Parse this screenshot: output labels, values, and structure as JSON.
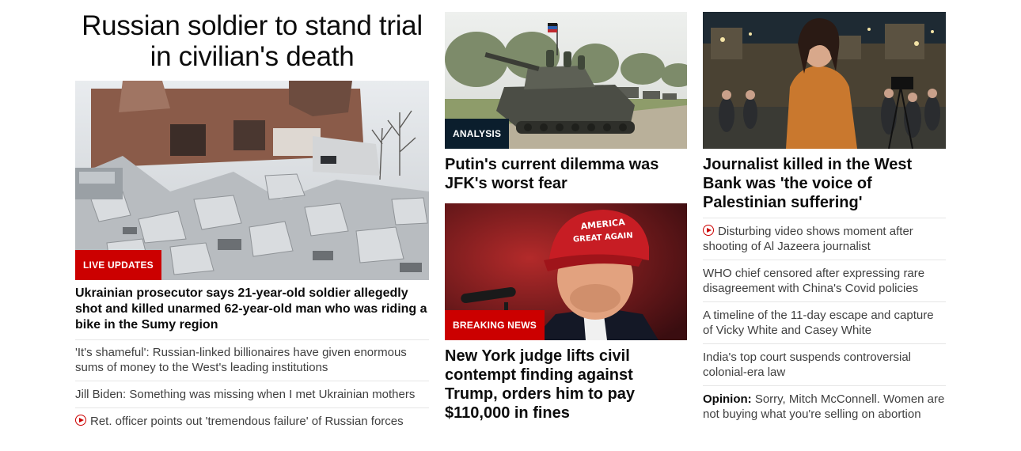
{
  "left": {
    "headline": "Russian soldier to stand trial in civilian's death",
    "badge": "LIVE UPDATES",
    "title": "Ukrainian prosecutor says 21-year-old soldier allegedly shot and killed unarmed 62-year-old man who was riding a bike in the Sumy region",
    "links": [
      {
        "text": "'It's shameful': Russian-linked billionaires have given enormous sums of money to the West's leading institutions",
        "video": false
      },
      {
        "text": "Jill Biden: Something was missing when I met Ukrainian mothers",
        "video": false
      },
      {
        "text": "Ret. officer points out 'tremendous failure' of Russian forces",
        "video": true
      }
    ]
  },
  "middle": {
    "top": {
      "badge": "ANALYSIS",
      "title": "Putin's current dilemma was JFK's worst fear"
    },
    "bottom": {
      "badge": "BREAKING NEWS",
      "cap_text_1": "AMERICA",
      "cap_text_2": "GREAT AGAIN",
      "title": "New York judge lifts civil contempt finding against Trump, orders him to pay $110,000 in fines"
    }
  },
  "right": {
    "title": "Journalist killed in the West Bank was 'the voice of Palestinian suffering'",
    "links": [
      {
        "text": "Disturbing video shows moment after shooting of Al Jazeera journalist",
        "video": true
      },
      {
        "text": "WHO chief censored after expressing rare disagreement with China's Covid policies",
        "video": false
      },
      {
        "text": "A timeline of the 11-day escape and capture of Vicky White and Casey White",
        "video": false
      },
      {
        "text": "India's top court suspends controversial colonial-era law",
        "video": false
      },
      {
        "text": "Sorry, Mitch McConnell. Women are not buying what you're selling on abortion",
        "video": false,
        "label": "Opinion:"
      }
    ]
  },
  "colors": {
    "badge_red": "#cc0000",
    "badge_navy": "#0b1e2d",
    "text": "#0c0c0c",
    "link_text": "#404040",
    "divider": "#e6e6e6"
  }
}
